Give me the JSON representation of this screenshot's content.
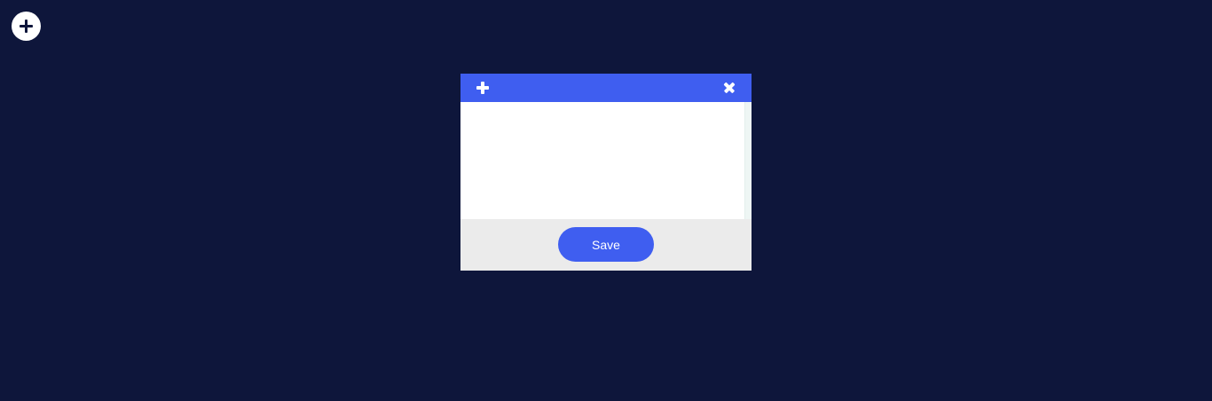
{
  "fab": {
    "icon": "plus-icon"
  },
  "modal": {
    "header": {
      "add_icon": "plus-icon",
      "close_icon": "close-icon",
      "accent_color": "#3f5ef0"
    },
    "body": {
      "value": "",
      "placeholder": ""
    },
    "footer": {
      "save_label": "Save"
    }
  },
  "colors": {
    "background": "#0e163b",
    "accent": "#3f5ef0",
    "footer": "#ebebeb"
  }
}
